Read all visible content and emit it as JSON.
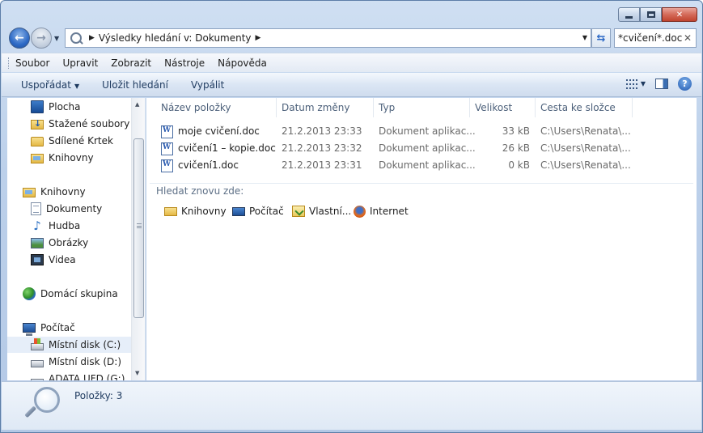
{
  "window": {
    "minimize_glyph": "minimize-icon",
    "maximize_glyph": "maximize-icon",
    "close_label": "✕"
  },
  "address": {
    "path_segment": "Výsledky hledání v: Dokumenty"
  },
  "search": {
    "value": "*cvičení*.doc"
  },
  "menu": {
    "items": [
      {
        "u": "S",
        "rest": "oubor"
      },
      {
        "u": "U",
        "rest": "pravit"
      },
      {
        "u": "Z",
        "rest": "obrazit"
      },
      {
        "u": "N",
        "rest": "ástroje"
      },
      {
        "u": "N",
        "pre": "Nápo",
        "rest": "ěda",
        "u2": "v"
      }
    ],
    "labels": [
      "Soubor",
      "Upravit",
      "Zobrazit",
      "Nástroje",
      "Nápověda"
    ]
  },
  "commands": {
    "organize": "Uspořádat",
    "save_search": "Uložit hledání",
    "burn": "Vypálit"
  },
  "nav": {
    "items": [
      {
        "label": "Plocha",
        "icon": "desktop-icon"
      },
      {
        "label": "Stažené soubory",
        "icon": "downloads-icon"
      },
      {
        "label": "Sdílené Krtek",
        "icon": "folder-icon"
      },
      {
        "label": "Knihovny",
        "icon": "libraries-icon"
      },
      {
        "label": "Knihovny",
        "icon": "libraries-icon"
      },
      {
        "label": "Dokumenty",
        "icon": "documents-icon"
      },
      {
        "label": "Hudba",
        "icon": "music-icon"
      },
      {
        "label": "Obrázky",
        "icon": "pictures-icon"
      },
      {
        "label": "Videa",
        "icon": "videos-icon"
      },
      {
        "label": "Domácí skupina",
        "icon": "homegroup-icon"
      },
      {
        "label": "Počítač",
        "icon": "computer-icon"
      },
      {
        "label": "Místní disk (C:)",
        "icon": "system-disk-icon"
      },
      {
        "label": "Místní disk (D:)",
        "icon": "disk-icon"
      },
      {
        "label": "ADATA UFD (G:)",
        "icon": "usb-drive-icon"
      }
    ]
  },
  "columns": {
    "name": "Název položky",
    "date": "Datum změny",
    "type": "Typ",
    "size": "Velikost",
    "path": "Cesta ke složce"
  },
  "files": [
    {
      "name": "moje cvičení.doc",
      "date": "21.2.2013 23:33",
      "type": "Dokument aplikac...",
      "size": "33 kB",
      "path": "C:\\Users\\Renata\\..."
    },
    {
      "name": "cvičení1 – kopie.doc",
      "date": "21.2.2013 23:32",
      "type": "Dokument aplikac...",
      "size": "26 kB",
      "path": "C:\\Users\\Renata\\..."
    },
    {
      "name": "cvičení1.doc",
      "date": "21.2.2013 23:31",
      "type": "Dokument aplikac...",
      "size": "0 kB",
      "path": "C:\\Users\\Renata\\..."
    }
  ],
  "search_again": {
    "label": "Hledat znovu zde:",
    "locations": [
      "Knihovny",
      "Počítač",
      "Vlastní...",
      "Internet"
    ]
  },
  "details": {
    "items_count": "Položky: 3"
  },
  "colors": {
    "accent": "#2d6ac6",
    "close_button": "#c0442f",
    "selection": "#e6eef9"
  }
}
